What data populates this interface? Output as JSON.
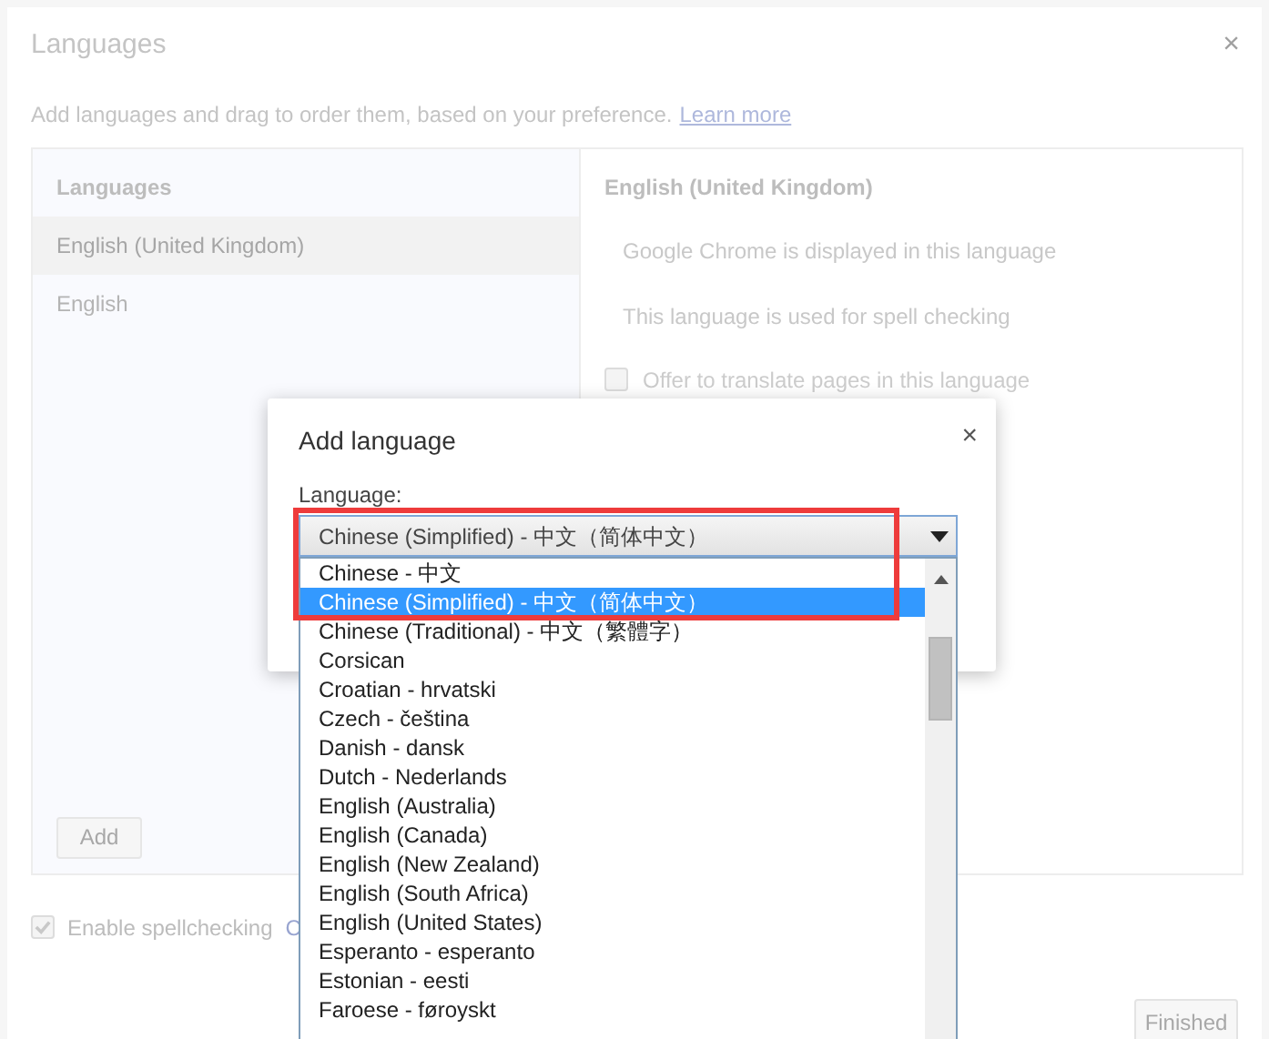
{
  "settings_dialog": {
    "title": "Languages",
    "close": "×",
    "description": "Add languages and drag to order them, based on your preference.",
    "learn_more_link": "Learn more",
    "languages_heading": "Languages",
    "languages": [
      {
        "name": "English (United Kingdom)",
        "selected": true
      },
      {
        "name": "English",
        "selected": false
      }
    ],
    "add_button": "Add",
    "details": {
      "heading": "English (United Kingdom)",
      "notes": [
        "Google Chrome is displayed in this language",
        "This language is used for spell checking"
      ],
      "translate_option": {
        "label": "Offer to translate pages in this language",
        "checked": false
      }
    },
    "spellcheck": {
      "label": "Enable spellchecking",
      "checked": true,
      "trailing_text": "C"
    },
    "finished_button": "Finished"
  },
  "add_language_dialog": {
    "title": "Add language",
    "close": "×",
    "field_label": "Language:",
    "selected_value": "Chinese (Simplified) - 中文（简体中文）"
  },
  "dropdown_options": [
    {
      "label": "Chinese - 中文",
      "selected": false
    },
    {
      "label": "Chinese (Simplified) - 中文（简体中文）",
      "selected": true
    },
    {
      "label": "Chinese (Traditional) - 中文（繁體字）",
      "selected": false
    },
    {
      "label": "Corsican",
      "selected": false
    },
    {
      "label": "Croatian - hrvatski",
      "selected": false
    },
    {
      "label": "Czech - čeština",
      "selected": false
    },
    {
      "label": "Danish - dansk",
      "selected": false
    },
    {
      "label": "Dutch - Nederlands",
      "selected": false
    },
    {
      "label": "English (Australia)",
      "selected": false
    },
    {
      "label": "English (Canada)",
      "selected": false
    },
    {
      "label": "English (New Zealand)",
      "selected": false
    },
    {
      "label": "English (South Africa)",
      "selected": false
    },
    {
      "label": "English (United States)",
      "selected": false
    },
    {
      "label": "Esperanto - esperanto",
      "selected": false
    },
    {
      "label": "Estonian - eesti",
      "selected": false
    },
    {
      "label": "Faroese - føroyskt",
      "selected": false
    }
  ],
  "highlight_frame": true
}
